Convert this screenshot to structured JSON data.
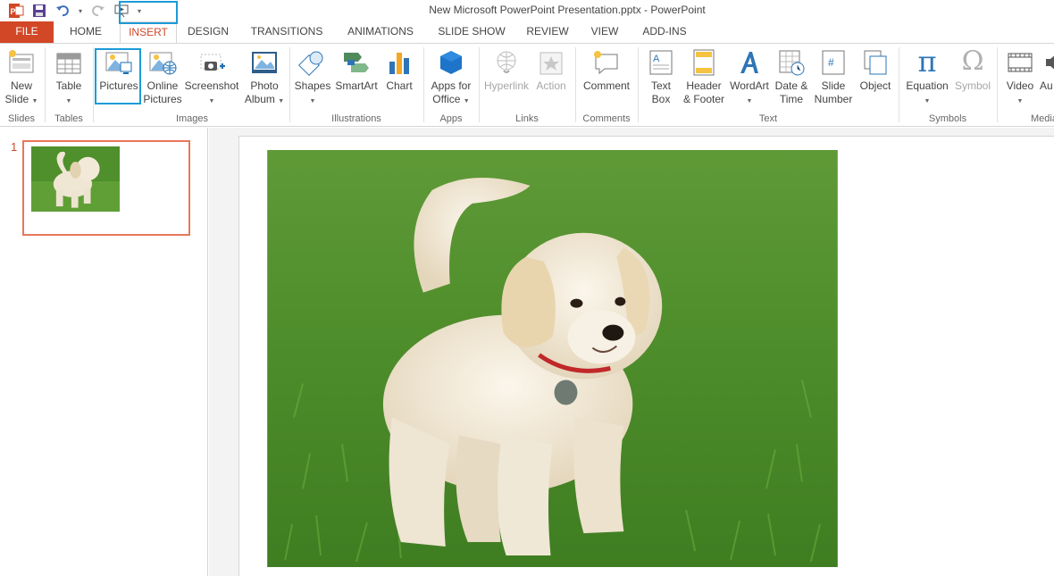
{
  "window": {
    "title": "New Microsoft PowerPoint Presentation.pptx - PowerPoint"
  },
  "qat": {
    "app_icon": "powerpoint-icon",
    "save_icon": "save-icon",
    "undo_icon": "undo-icon",
    "redo_icon": "redo-icon",
    "slideshow_icon": "start-from-beginning-icon",
    "customize_icon": "customize-qat-icon"
  },
  "tabs": [
    {
      "label": "FILE"
    },
    {
      "label": "HOME"
    },
    {
      "label": "INSERT"
    },
    {
      "label": "DESIGN"
    },
    {
      "label": "TRANSITIONS"
    },
    {
      "label": "ANIMATIONS"
    },
    {
      "label": "SLIDE SHOW"
    },
    {
      "label": "REVIEW"
    },
    {
      "label": "VIEW"
    },
    {
      "label": "ADD-INS"
    }
  ],
  "ribbon": {
    "groups": {
      "slides": "Slides",
      "tables": "Tables",
      "images": "Images",
      "illustrations": "Illustrations",
      "apps": "Apps",
      "links": "Links",
      "comments": "Comments",
      "text": "Text",
      "symbols": "Symbols",
      "media": "Media"
    },
    "buttons": {
      "new_slide": [
        "New",
        "Slide"
      ],
      "table": "Table",
      "pictures": "Pictures",
      "online_pictures": [
        "Online",
        "Pictures"
      ],
      "screenshot": "Screenshot",
      "photo_album": [
        "Photo",
        "Album"
      ],
      "shapes": "Shapes",
      "smartart": "SmartArt",
      "chart": "Chart",
      "apps_for_office": [
        "Apps for",
        "Office"
      ],
      "hyperlink": "Hyperlink",
      "action": "Action",
      "comment": "Comment",
      "text_box": [
        "Text",
        "Box"
      ],
      "header_footer": [
        "Header",
        "& Footer"
      ],
      "wordart": "WordArt",
      "date_time": [
        "Date &",
        "Time"
      ],
      "slide_number": [
        "Slide",
        "Number"
      ],
      "object": "Object",
      "equation": "Equation",
      "symbol": "Symbol",
      "video": "Video",
      "audio": "Au"
    }
  },
  "slides_pane": {
    "slide_number": "1"
  },
  "colors": {
    "accent": "#d24726",
    "highlight": "#1b9bd7",
    "grass": "#4f8f2c",
    "puppy": "#efe6d4"
  }
}
